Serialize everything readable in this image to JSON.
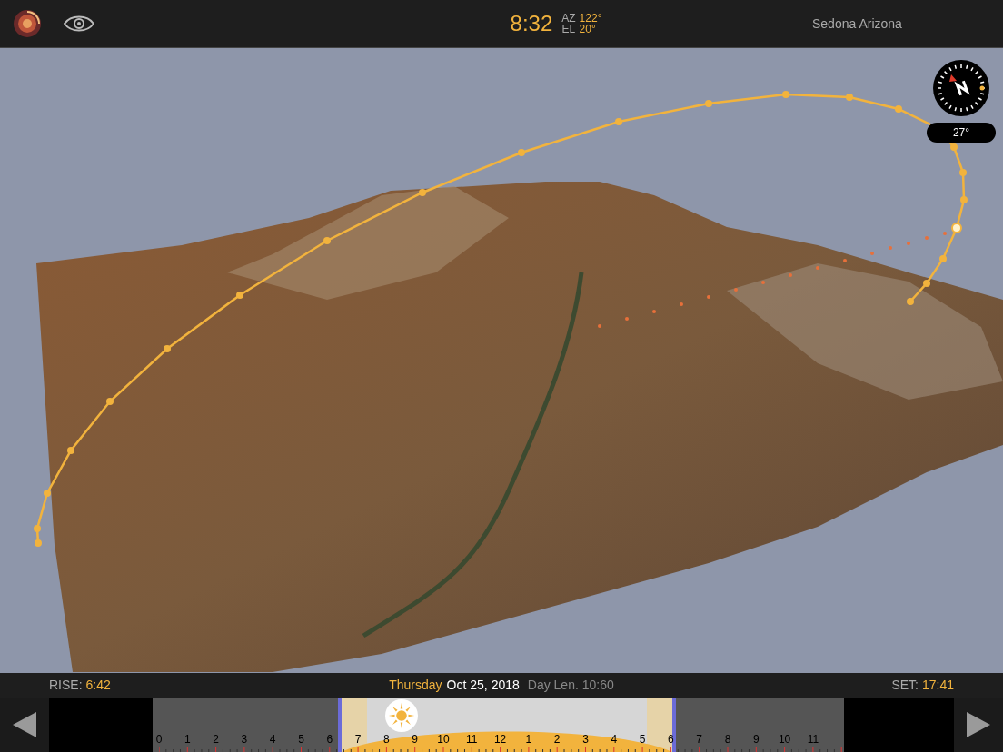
{
  "top_bar": {
    "time": "8:32",
    "azimuth_label": "AZ",
    "azimuth": "122°",
    "elevation_label": "EL",
    "elevation": "20°",
    "location": "Sedona Arizona"
  },
  "map": {
    "compass_heading": "27°"
  },
  "info_bar": {
    "rise_label": "RISE:",
    "rise": "6:42",
    "weekday": "Thursday",
    "date": "Oct 25, 2018",
    "day_length": "Day Len. 10:60",
    "set_label": "SET:",
    "set": "17:41"
  },
  "timeline": {
    "sun": {
      "level": 0.355
    },
    "hours": [
      "0",
      "1",
      "2",
      "3",
      "4",
      "5",
      "6",
      "7",
      "8",
      "9",
      "10",
      "11",
      "12",
      "1",
      "2",
      "3",
      "4",
      "5",
      "6",
      "7",
      "8",
      "9",
      "10",
      "11"
    ]
  }
}
